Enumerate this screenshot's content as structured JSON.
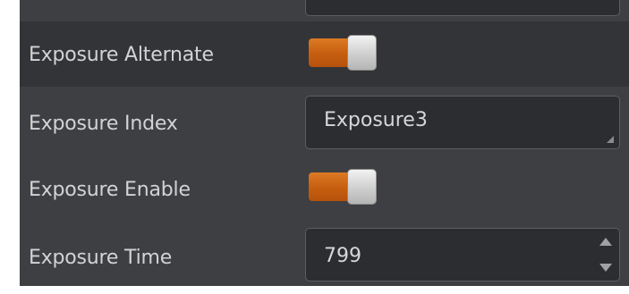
{
  "properties": [
    {
      "label": "Exposure Alternate",
      "type": "toggle",
      "value": true,
      "selected": true
    },
    {
      "label": "Exposure Index",
      "type": "dropdown",
      "value": "Exposure3"
    },
    {
      "label": "Exposure Enable",
      "type": "toggle",
      "value": true
    },
    {
      "label": "Exposure Time",
      "type": "spinbox",
      "value": "799"
    }
  ],
  "colors": {
    "panel_background": "#3e3f42",
    "selected_row": "#333437",
    "field_background": "#2c2d30",
    "toggle_on": "#c65e10",
    "text": "#d2d3d5"
  }
}
